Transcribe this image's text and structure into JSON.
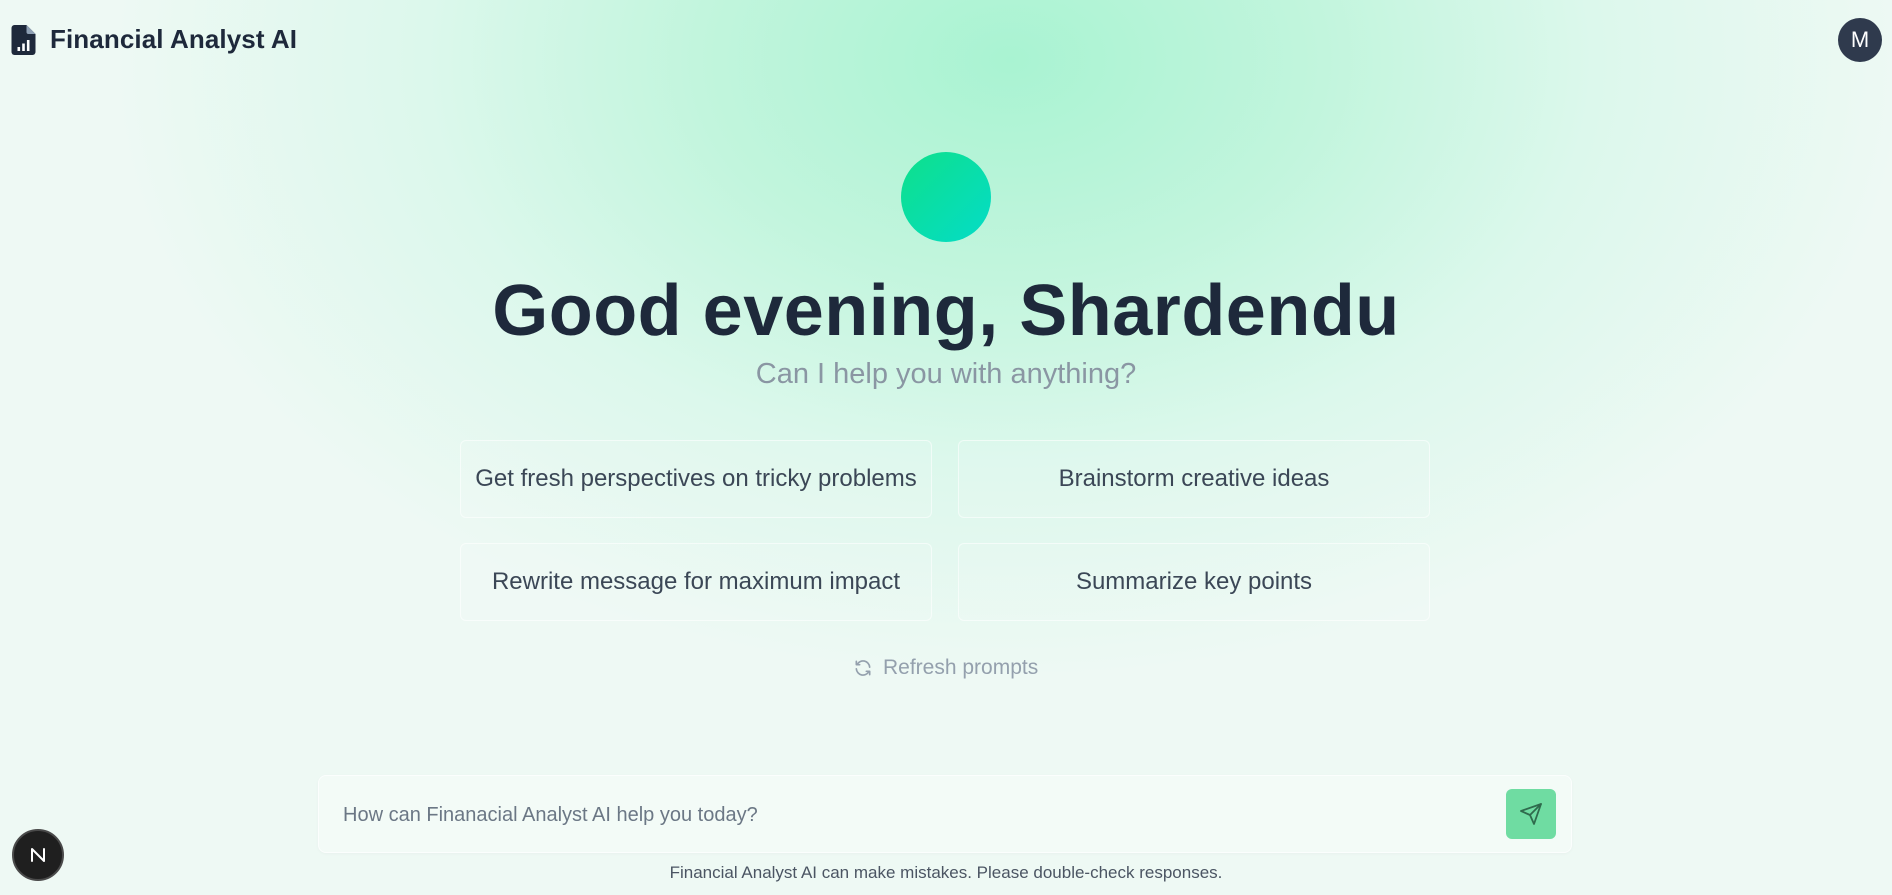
{
  "header": {
    "app_title": "Financial Analyst AI",
    "logo_icon": "file-chart-icon",
    "avatar_initial": "M"
  },
  "hero": {
    "greeting": "Good evening, Shardendu",
    "subtitle": "Can I help you with anything?",
    "orb_colors": [
      "#0ee08a",
      "#04dcc8"
    ]
  },
  "prompts": [
    {
      "label": "Get fresh perspectives on tricky problems"
    },
    {
      "label": "Brainstorm creative ideas"
    },
    {
      "label": "Rewrite message for maximum impact"
    },
    {
      "label": "Summarize key points"
    }
  ],
  "refresh": {
    "label": "Refresh prompts",
    "icon": "refresh-icon"
  },
  "composer": {
    "value": "",
    "placeholder": "How can Finanacial Analyst AI help you today?",
    "send_icon": "send-icon"
  },
  "footer": {
    "disclaimer": "Financial Analyst AI can make mistakes. Please double-check responses."
  },
  "dev_badge": {
    "letter": "N"
  },
  "colors": {
    "accent": "#6fdca2",
    "text_primary": "#1e293b",
    "text_muted": "#8a96a3"
  }
}
